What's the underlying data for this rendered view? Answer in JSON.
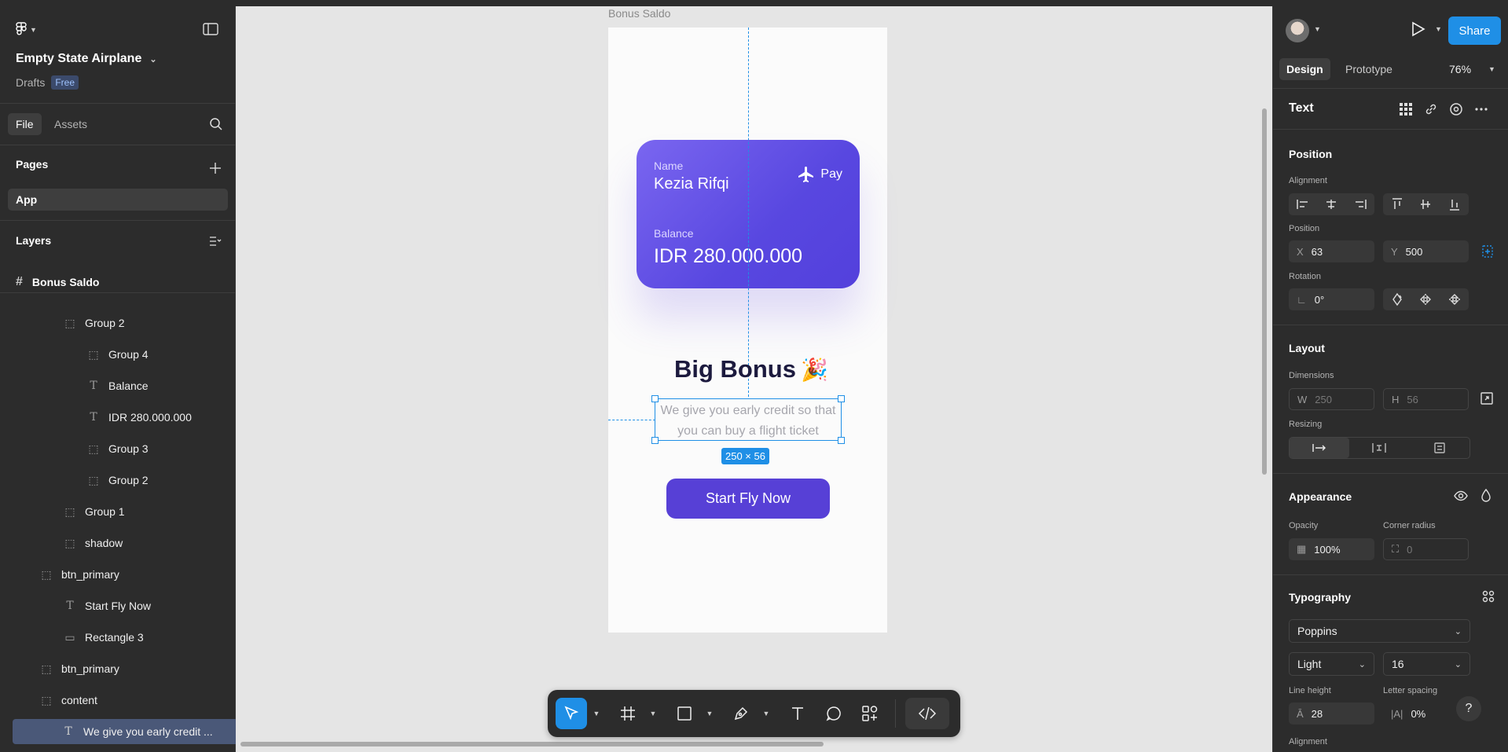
{
  "file": {
    "title": "Empty State Airplane",
    "location": "Drafts",
    "plan_badge": "Free"
  },
  "left_tabs": {
    "file": "File",
    "assets": "Assets"
  },
  "pages": {
    "heading": "Pages",
    "items": [
      "App"
    ]
  },
  "layers": {
    "heading": "Layers",
    "frame": "Bonus Saldo",
    "items": [
      {
        "label": "Group 2",
        "type": "group"
      },
      {
        "label": "Group 4",
        "type": "group"
      },
      {
        "label": "Balance",
        "type": "text"
      },
      {
        "label": "IDR 280.000.000",
        "type": "text"
      },
      {
        "label": "Group 3",
        "type": "group"
      },
      {
        "label": "Group 2",
        "type": "group"
      },
      {
        "label": "Group 1",
        "type": "group"
      },
      {
        "label": "shadow",
        "type": "group"
      },
      {
        "label": "btn_primary",
        "type": "group"
      },
      {
        "label": "Start Fly Now",
        "type": "text"
      },
      {
        "label": "Rectangle 3",
        "type": "rect"
      },
      {
        "label": "btn_primary",
        "type": "group"
      },
      {
        "label": "content",
        "type": "group"
      },
      {
        "label": "We give you early credit ...",
        "type": "text",
        "selected": true
      }
    ]
  },
  "canvas": {
    "frame_label": "Bonus Saldo",
    "card": {
      "name_label": "Name",
      "name_value": "Kezia Rifqi",
      "pay_label": "Pay",
      "balance_label": "Balance",
      "balance_value": "IDR 280.000.000"
    },
    "title": "Big Bonus",
    "title_emoji": "🎉",
    "body": "We give you early credit so that you can buy a flight ticket",
    "selection_size": "250 × 56",
    "cta": "Start Fly Now"
  },
  "right": {
    "share": "Share",
    "tabs": {
      "design": "Design",
      "prototype": "Prototype"
    },
    "zoom": "76%",
    "layer_type": "Text",
    "position": {
      "heading": "Position",
      "alignment_label": "Alignment",
      "position_label": "Position",
      "x_label": "X",
      "x": "63",
      "y_label": "Y",
      "y": "500",
      "rotation_label": "Rotation",
      "rotation": "0°"
    },
    "layout": {
      "heading": "Layout",
      "dimensions_label": "Dimensions",
      "w_label": "W",
      "w": "250",
      "h_label": "H",
      "h": "56",
      "resizing_label": "Resizing"
    },
    "appearance": {
      "heading": "Appearance",
      "opacity_label": "Opacity",
      "opacity": "100%",
      "radius_label": "Corner radius",
      "radius": "0"
    },
    "typography": {
      "heading": "Typography",
      "font": "Poppins",
      "weight": "Light",
      "size": "16",
      "line_height_label": "Line height",
      "line_height": "28",
      "letter_spacing_label": "Letter spacing",
      "letter_spacing": "0%",
      "alignment_label": "Alignment"
    }
  },
  "colors": {
    "accent": "#1f8fe6",
    "card_gradient_start": "#7a66f0",
    "card_gradient_end": "#5340dc",
    "cta": "#5740d6",
    "title_text": "#1c1a3e"
  }
}
